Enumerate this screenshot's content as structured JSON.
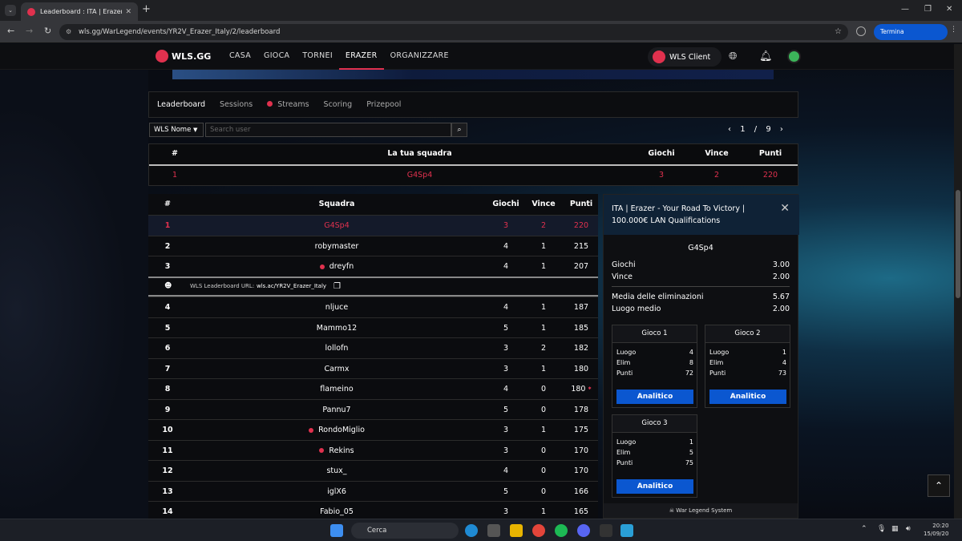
{
  "browser": {
    "tab_title": "Leaderboard : ITA | Erazer - Your",
    "url": "wls.gg/WarLegend/events/YR2V_Erazer_Italy/2/leaderboard",
    "update_button": "Termina aggiornamento"
  },
  "site": {
    "logo": "WLS.GG",
    "menu": [
      "CASA",
      "GIOCA",
      "TORNEI",
      "ERAZER",
      "ORGANIZZARE"
    ],
    "client": "WLS Client"
  },
  "subnav": {
    "leaderboard": "Leaderboard",
    "sessions": "Sessions",
    "streams": "Streams",
    "scoring": "Scoring",
    "prizepool": "Prizepool"
  },
  "filters": {
    "select": "WLS Nome",
    "search_placeholder": "Search user"
  },
  "pager": {
    "current": "1",
    "separator": "/",
    "total": "9"
  },
  "my_team": {
    "headers": {
      "rank": "#",
      "team": "La tua squadra",
      "games": "Giochi",
      "wins": "Vince",
      "points": "Punti"
    },
    "row": {
      "rank": "1",
      "team": "G4Sp4",
      "games": "3",
      "wins": "2",
      "points": "220"
    }
  },
  "leaderboard": {
    "headers": {
      "rank": "#",
      "team": "Squadra",
      "games": "Giochi",
      "wins": "Vince",
      "points": "Punti"
    },
    "url_label": "WLS Leaderboard URL:",
    "url_value": "wls.ac/YR2V_Erazer_Italy",
    "rows": [
      {
        "rank": "1",
        "team": "G4Sp4",
        "games": "3",
        "wins": "2",
        "points": "220"
      },
      {
        "rank": "2",
        "team": "robymaster",
        "games": "4",
        "wins": "1",
        "points": "215"
      },
      {
        "rank": "3",
        "team": "dreyfn",
        "games": "4",
        "wins": "1",
        "points": "207"
      },
      {
        "rank": "4",
        "team": "nljuce",
        "games": "4",
        "wins": "1",
        "points": "187"
      },
      {
        "rank": "5",
        "team": "Mammo12",
        "games": "5",
        "wins": "1",
        "points": "185"
      },
      {
        "rank": "6",
        "team": "lollofn",
        "games": "3",
        "wins": "2",
        "points": "182"
      },
      {
        "rank": "7",
        "team": "Carmx",
        "games": "3",
        "wins": "1",
        "points": "180"
      },
      {
        "rank": "8",
        "team": "flameino",
        "games": "4",
        "wins": "0",
        "points": "180"
      },
      {
        "rank": "9",
        "team": "Pannu7",
        "games": "5",
        "wins": "0",
        "points": "178"
      },
      {
        "rank": "10",
        "team": "RondoMiglio",
        "games": "3",
        "wins": "1",
        "points": "175"
      },
      {
        "rank": "11",
        "team": "Rekins",
        "games": "3",
        "wins": "0",
        "points": "170"
      },
      {
        "rank": "12",
        "team": "stux_",
        "games": "4",
        "wins": "0",
        "points": "170"
      },
      {
        "rank": "13",
        "team": "iglX6",
        "games": "5",
        "wins": "0",
        "points": "166"
      },
      {
        "rank": "14",
        "team": "Fabio_05",
        "games": "3",
        "wins": "1",
        "points": "165"
      }
    ]
  },
  "side": {
    "title": "ITA | Erazer - Your Road To Victory | 100.000€ LAN Qualifications",
    "team": "G4Sp4",
    "stats": [
      {
        "label": "Giochi",
        "value": "3.00"
      },
      {
        "label": "Vince",
        "value": "2.00"
      },
      {
        "label": "Media delle eliminazioni",
        "value": "5.67"
      },
      {
        "label": "Luogo medio",
        "value": "2.00"
      }
    ],
    "games": [
      {
        "title": "Gioco 1",
        "place_label": "Luogo",
        "place": "4",
        "elim_label": "Elim",
        "elim": "8",
        "points_label": "Punti",
        "points": "72",
        "button": "Analitico"
      },
      {
        "title": "Gioco 2",
        "place_label": "Luogo",
        "place": "1",
        "elim_label": "Elim",
        "elim": "4",
        "points_label": "Punti",
        "points": "73",
        "button": "Analitico"
      },
      {
        "title": "Gioco 3",
        "place_label": "Luogo",
        "place": "1",
        "elim_label": "Elim",
        "elim": "5",
        "points_label": "Punti",
        "points": "75",
        "button": "Analitico"
      }
    ],
    "footer": "War Legend System"
  },
  "taskbar": {
    "search": "Cerca",
    "time": "20:20",
    "date": "15/09/20"
  },
  "colors": {
    "accent": "#e0314e",
    "button": "#0b57d0"
  }
}
